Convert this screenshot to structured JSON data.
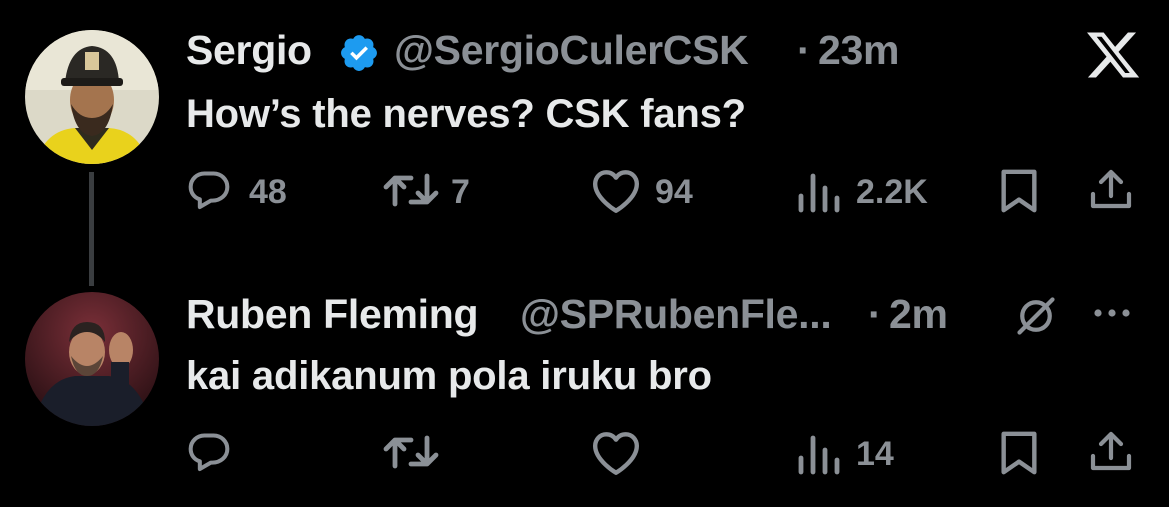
{
  "colors": {
    "background": "#000000",
    "text_primary": "#e7e9ea",
    "text_secondary": "#8b9096",
    "verified_blue": "#1d9bf0"
  },
  "tweets": [
    {
      "display_name": "Sergio",
      "verified": true,
      "handle": "@SergioCulerCSK",
      "separator": "·",
      "time": "23m",
      "text": "How’s the nerves? CSK fans?",
      "actions": {
        "replies": "48",
        "retweets": "7",
        "likes": "94",
        "views": "2.2K"
      },
      "top_right_icon": "x-logo-icon"
    },
    {
      "display_name": "Ruben Fleming",
      "verified": false,
      "handle": "@SPRubenFle...",
      "separator": "·",
      "time": "2m",
      "text": "kai adikanum pola iruku bro",
      "actions": {
        "replies": "",
        "retweets": "",
        "likes": "",
        "views": "14"
      },
      "top_right_icons": [
        "grok-icon",
        "more-icon"
      ]
    }
  ]
}
